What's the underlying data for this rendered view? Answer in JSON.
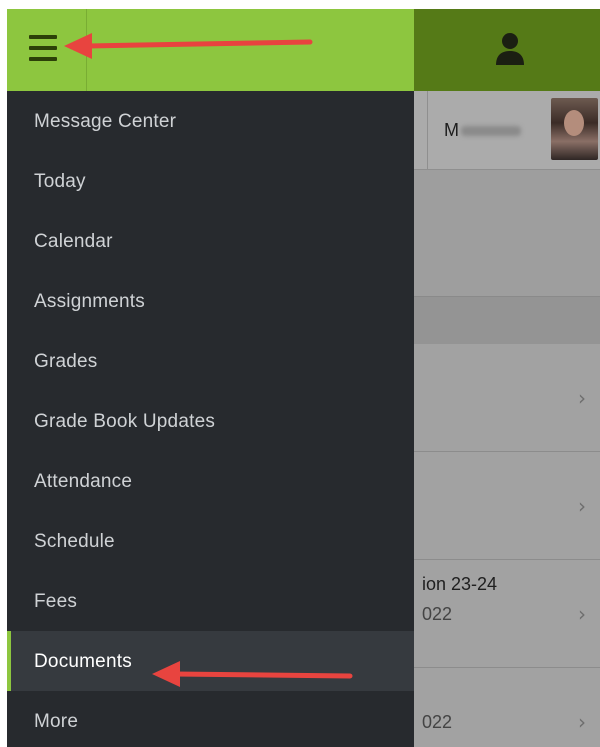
{
  "header": {
    "menu_icon": "hamburger-menu-icon",
    "profile_icon": "person-icon",
    "brand_color": "#8dc63f"
  },
  "user": {
    "name_visible": "M"
  },
  "menu": {
    "items": [
      {
        "label": "Message Center",
        "active": false
      },
      {
        "label": "Today",
        "active": false
      },
      {
        "label": "Calendar",
        "active": false
      },
      {
        "label": "Assignments",
        "active": false
      },
      {
        "label": "Grades",
        "active": false
      },
      {
        "label": "Grade Book Updates",
        "active": false
      },
      {
        "label": "Attendance",
        "active": false
      },
      {
        "label": "Schedule",
        "active": false
      },
      {
        "label": "Fees",
        "active": false
      },
      {
        "label": "Documents",
        "active": true
      },
      {
        "label": "More",
        "active": false
      }
    ]
  },
  "background_list": {
    "rows": [
      {
        "title": "",
        "subtitle": ""
      },
      {
        "title": "",
        "subtitle": ""
      },
      {
        "title": "ion 23-24",
        "subtitle": "022"
      },
      {
        "title": "",
        "subtitle": "022"
      }
    ]
  },
  "annotations": {
    "arrow_color": "#e8443f"
  }
}
